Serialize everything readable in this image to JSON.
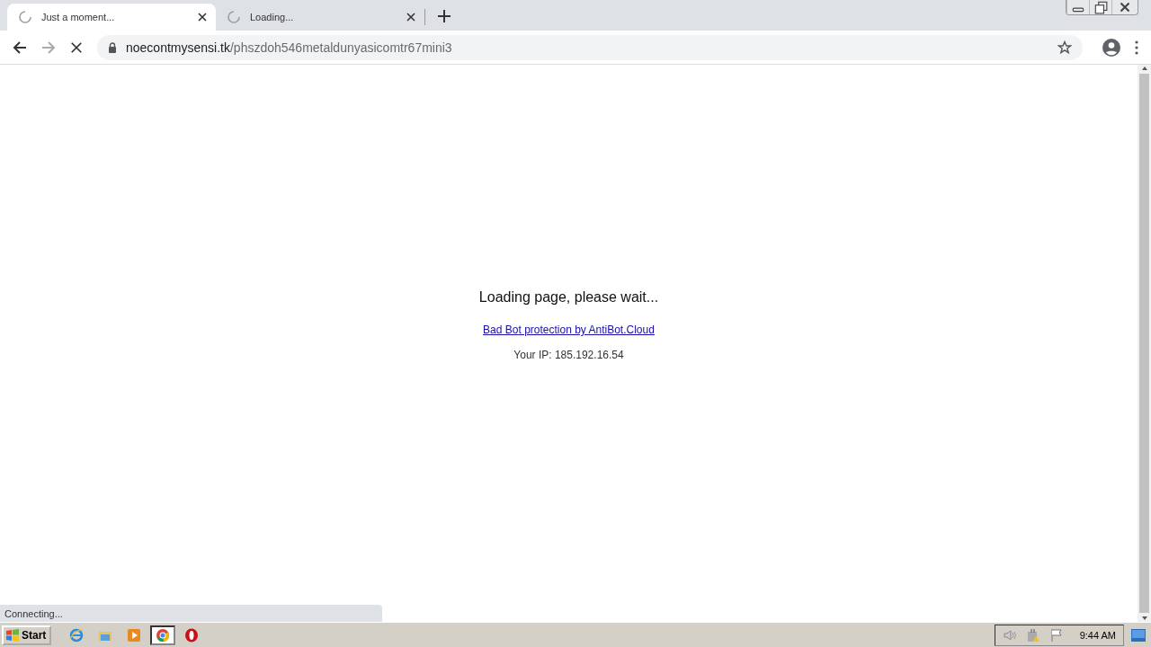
{
  "tabs": [
    {
      "title": "Just a moment...",
      "selected": true
    },
    {
      "title": "Loading...",
      "selected": false
    }
  ],
  "address": {
    "host": "noecontmysensi.tk",
    "path": "/phszdoh546metaldunyasicomtr67mini3"
  },
  "page": {
    "heading": "Loading page, please wait...",
    "link": "Bad Bot protection by AntiBot.Cloud",
    "ip": "Your IP: 185.192.16.54"
  },
  "status_bar": "Connecting...",
  "taskbar": {
    "start": "Start",
    "apps": [
      {
        "kind": "ie",
        "selected": false
      },
      {
        "kind": "folder",
        "selected": false
      },
      {
        "kind": "media",
        "selected": false
      },
      {
        "kind": "chrome",
        "selected": true
      },
      {
        "kind": "opera",
        "selected": false
      }
    ],
    "clock": "9:44 AM"
  }
}
